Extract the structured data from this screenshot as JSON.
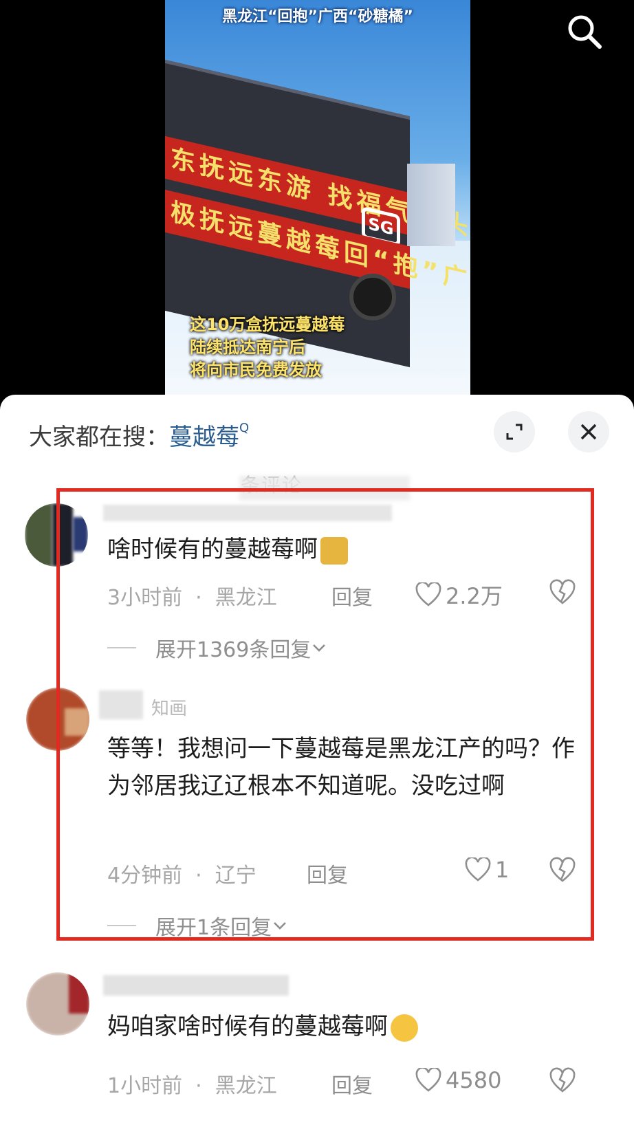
{
  "video": {
    "caption_top": "黑龙江“回抱”广西“砂糖橘”",
    "banner_line1": "东抚远东游 找福气请头",
    "banner_line2": "极抚远蔓越莓回“抱”广西砂糖橘",
    "truck_logo": "SG",
    "caption_bottom_1": "这10万盒抚远蔓越莓",
    "caption_bottom_2": "陆续抵达南宁后",
    "caption_bottom_3": "将向市民免费发放"
  },
  "header": {
    "hint_label": "大家都在搜：",
    "hint_term": "蔓越莓",
    "comment_count": "条评论"
  },
  "comments": [
    {
      "text": "啥时候有的蔓越莓啊",
      "time": "3小时前",
      "location": "黑龙江",
      "reply_label": "回复",
      "likes": "2.2万",
      "expand": "展开1369条回复"
    },
    {
      "name": "知画",
      "text": "等等！我想问一下蔓越莓是黑龙江产的吗？作为邻居我辽辽根本不知道呢。没吃过啊",
      "time": "4分钟前",
      "location": "辽宁",
      "reply_label": "回复",
      "likes": "1",
      "expand": "展开1条回复"
    },
    {
      "text": "妈咱家啥时候有的蔓越莓啊",
      "time": "1小时前",
      "location": "黑龙江",
      "reply_label": "回复",
      "likes": "4580"
    }
  ],
  "colors": {
    "highlight_border": "#e32a20",
    "hint_term": "#2a5c8f",
    "meta_text": "#a6a6a6"
  },
  "icons": [
    "search-icon",
    "expand-icon",
    "close-icon",
    "heart-icon",
    "broken-heart-icon",
    "chevron-down-icon"
  ]
}
